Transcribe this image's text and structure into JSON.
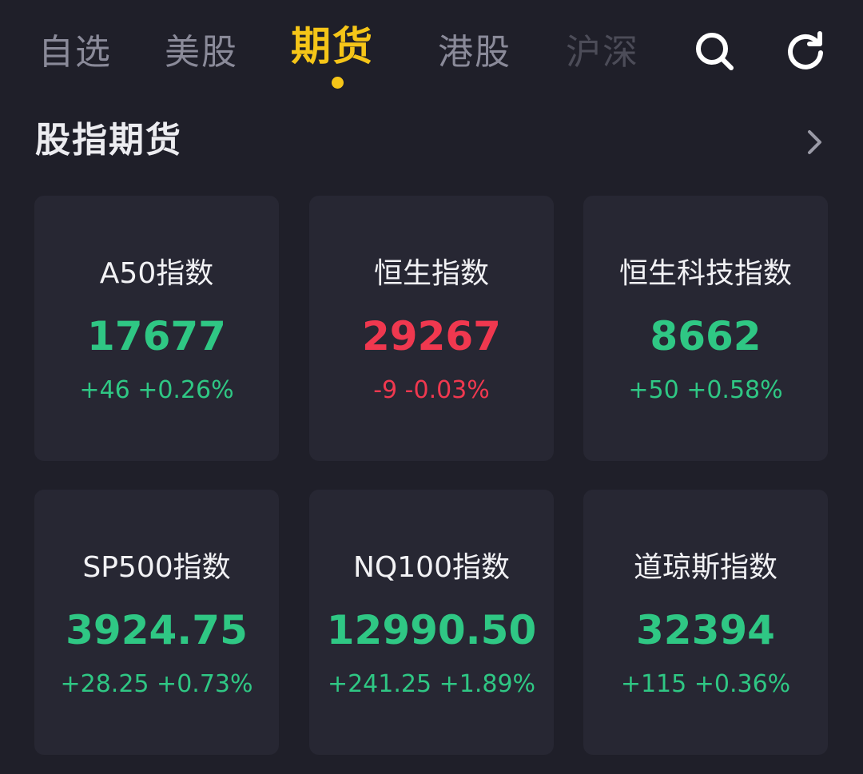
{
  "tabs": [
    {
      "label": "自选",
      "state": "inactive"
    },
    {
      "label": "美股",
      "state": "inactive"
    },
    {
      "label": "期货",
      "state": "active"
    },
    {
      "label": "港股",
      "state": "inactive"
    },
    {
      "label": "沪深",
      "state": "faded"
    }
  ],
  "icons": {
    "search": "search-icon",
    "refresh": "refresh-icon",
    "more": "chevron-right-icon"
  },
  "section": {
    "title": "股指期货"
  },
  "colors": {
    "up": "#2fc784",
    "down": "#f0384f",
    "accent": "#f5c518",
    "background": "#1f1f29",
    "card": "#272733"
  },
  "cards": [
    {
      "name": "A50指数",
      "price": "17677",
      "change": "+46 +0.26%",
      "direction": "up"
    },
    {
      "name": "恒生指数",
      "price": "29267",
      "change": "-9 -0.03%",
      "direction": "down"
    },
    {
      "name": "恒生科技指数",
      "price": "8662",
      "change": "+50 +0.58%",
      "direction": "up"
    },
    {
      "name": "SP500指数",
      "price": "3924.75",
      "change": "+28.25 +0.73%",
      "direction": "up"
    },
    {
      "name": "NQ100指数",
      "price": "12990.50",
      "change": "+241.25 +1.89%",
      "direction": "up"
    },
    {
      "name": "道琼斯指数",
      "price": "32394",
      "change": "+115 +0.36%",
      "direction": "up"
    }
  ]
}
